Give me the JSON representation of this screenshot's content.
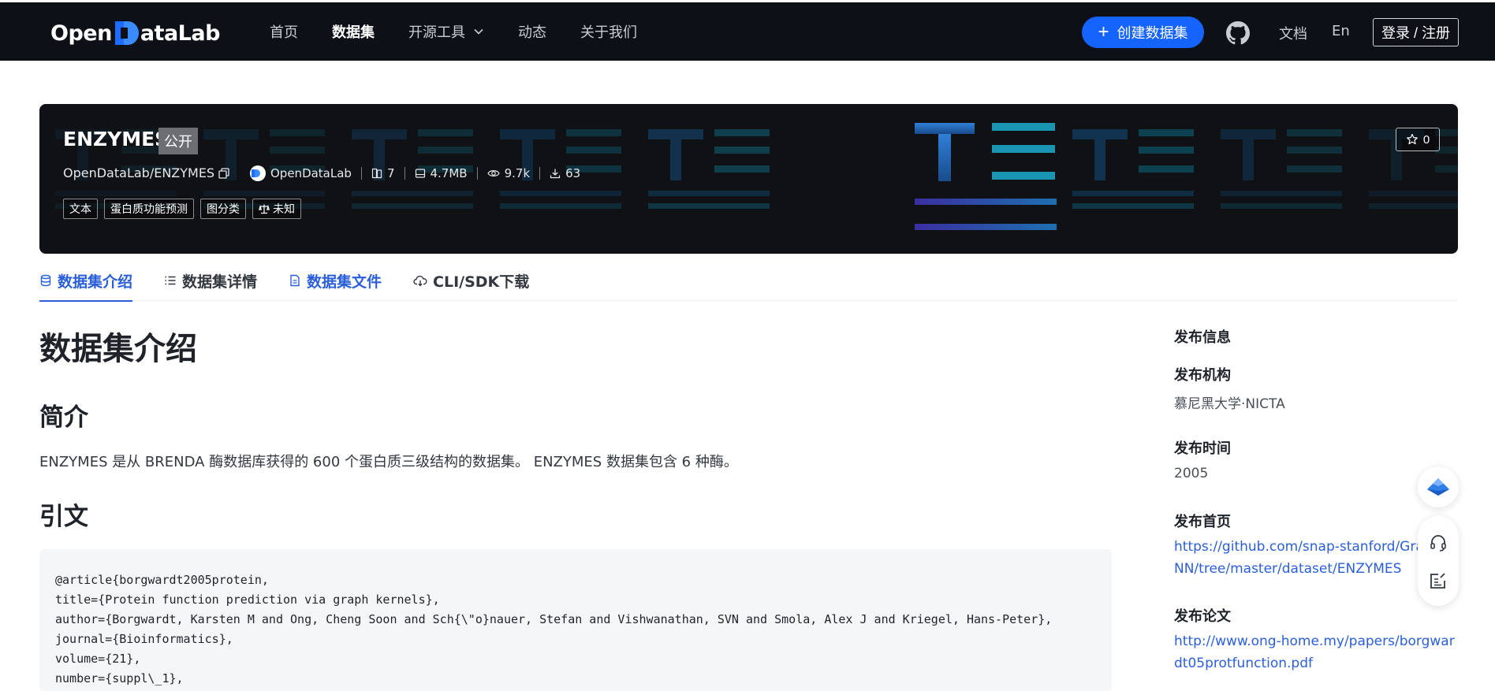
{
  "nav": {
    "logo_open": "Open",
    "logo_rest": "ataLab",
    "items": [
      {
        "label": "首页"
      },
      {
        "label": "数据集"
      },
      {
        "label": "开源工具"
      },
      {
        "label": "动态"
      },
      {
        "label": "关于我们"
      }
    ],
    "create_label": "创建数据集",
    "docs_label": "文档",
    "lang_label": "En",
    "login_label": "登录 / 注册"
  },
  "banner": {
    "title": "ENZYMES",
    "visibility": "公开",
    "path": "OpenDataLab/ENZYMES",
    "org": "OpenDataLab",
    "files_count": "7",
    "size": "4.7MB",
    "views": "9.7k",
    "downloads": "63",
    "tags": [
      "文本",
      "蛋白质功能预测",
      "图分类",
      "未知"
    ],
    "stars": "0"
  },
  "tabs": [
    {
      "label": "数据集介绍"
    },
    {
      "label": "数据集详情"
    },
    {
      "label": "数据集文件"
    },
    {
      "label": "CLI/SDK下载"
    }
  ],
  "content": {
    "page_title": "数据集介绍",
    "intro_heading": "简介",
    "intro_text": "ENZYMES 是从 BRENDA 酶数据库获得的 600 个蛋白质三级结构的数据集。 ENZYMES 数据集包含 6 种酶。",
    "citation_heading": "引文",
    "citation_code": "@article{borgwardt2005protein,\ntitle={Protein function prediction via graph kernels},\nauthor={Borgwardt, Karsten M and Ong, Cheng Soon and Sch{\\\"o}nauer, Stefan and Vishwanathan, SVN and Smola, Alex J and Kriegel, Hans-Peter},\njournal={Bioinformatics},\nvolume={21},\nnumber={suppl\\_1},"
  },
  "sidebar": {
    "section_title": "发布信息",
    "org_label": "发布机构",
    "org_value": "慕尼黑大学·NICTA",
    "time_label": "发布时间",
    "time_value": "2005",
    "homepage_label": "发布首页",
    "homepage_value": "https://github.com/snap-stanford/GraphRNN/tree/master/dataset/ENZYMES",
    "paper_label": "发布论文",
    "paper_value": "http://www.ong-home.my/papers/borgwardt05protfunction.pdf"
  },
  "colors": {
    "nav_bg": "#0d1117",
    "accent": "#1664ff",
    "link": "#2b5fd9"
  }
}
